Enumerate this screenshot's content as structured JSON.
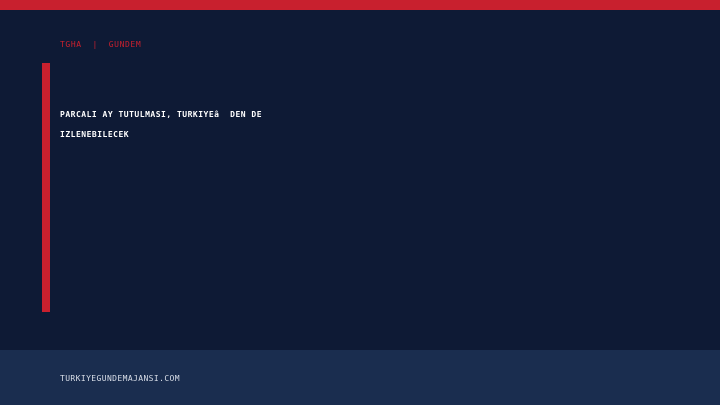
{
  "header": {
    "kicker": "TGHA  |  GUNDEM"
  },
  "article": {
    "headline_line1": "PARCALI AY TUTULMASI, TURKIYEâ  DEN DE",
    "headline_line2": "IZLENEBILECEK"
  },
  "footer": {
    "url": "TURKIYEGUNDEMAJANSI.COM"
  },
  "colors": {
    "accent": "#c8202e",
    "background": "#0e1a35",
    "footer_background": "#1a2d4f",
    "text": "#ffffff"
  }
}
